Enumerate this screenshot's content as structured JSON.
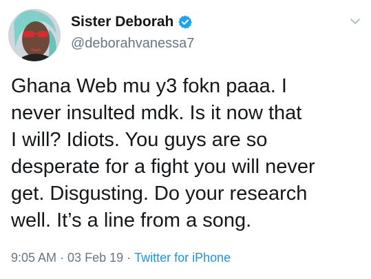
{
  "author": {
    "display_name": "Sister Deborah",
    "handle": "@deborahvanessa7",
    "verified": true,
    "verified_color": "#1da1f2"
  },
  "icons": {
    "verified": "verified-badge-icon",
    "menu": "chevron-down-icon"
  },
  "tweet": {
    "text": "Ghana Web mu y3 fokn paaa. I\nnever insulted mdk. Is it now that\nI will? Idiots. You guys are so\ndesperate for a fight you will never\nget. Disgusting. Do your research\nwell. It’s a line from a song."
  },
  "meta": {
    "time": "9:05 AM",
    "separator": "·",
    "date": "03 Feb 19",
    "source": "Twitter for iPhone"
  },
  "colors": {
    "secondary_text": "#657786",
    "link": "#1b95e0"
  }
}
